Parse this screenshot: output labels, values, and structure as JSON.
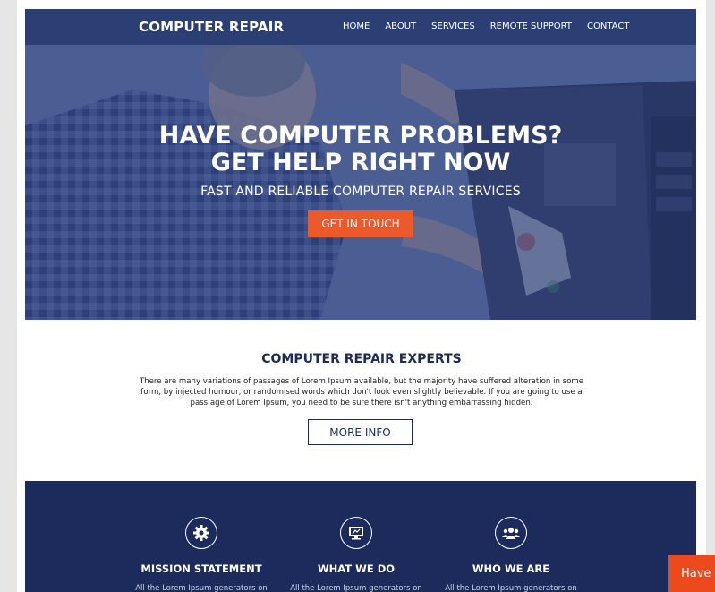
{
  "brand": "COMPUTER REPAIR",
  "nav": [
    "HOME",
    "ABOUT",
    "SERVICES",
    "REMOTE SUPPORT",
    "CONTACT"
  ],
  "hero": {
    "title_line1": "HAVE COMPUTER PROBLEMS?",
    "title_line2": "GET HELP RIGHT NOW",
    "subtitle": "FAST AND RELIABLE COMPUTER REPAIR SERVICES",
    "cta": "GET IN TOUCH"
  },
  "about": {
    "title": "COMPUTER REPAIR EXPERTS",
    "text": "There are many variations of passages of Lorem Ipsum available, but the majority have suffered alteration in some form, by injected humour, or randomised words which don't look even slightly believable. If you are going to use a pass age of Lorem Ipsum, you need to be sure there isn't anything embarrassing hidden.",
    "button": "MORE INFO"
  },
  "features": [
    {
      "title": "MISSION STATEMENT",
      "text": "All the Lorem Ipsum generators on",
      "icon": "gear-icon"
    },
    {
      "title": "WHAT WE DO",
      "text": "All the Lorem Ipsum generators on",
      "icon": "monitor-icon"
    },
    {
      "title": "WHO WE ARE",
      "text": "All the Lorem Ipsum generators on",
      "icon": "people-icon"
    }
  ],
  "chat_tab": "Have",
  "colors": {
    "navy": "#1c2b5c",
    "accent": "#ec5a2c"
  }
}
